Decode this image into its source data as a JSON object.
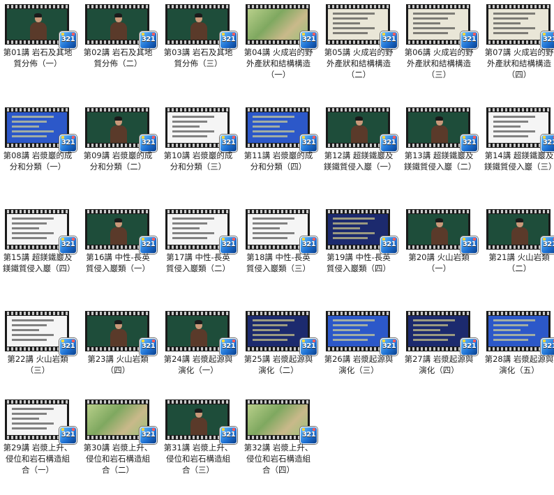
{
  "badge": "321",
  "lectures": [
    {
      "caption": "第01講 岩石及其地質分佈（一）",
      "scene": "board"
    },
    {
      "caption": "第02講 岩石及其地質分佈（二）",
      "scene": "board"
    },
    {
      "caption": "第03講 岩石及其地質分佈（三）",
      "scene": "board"
    },
    {
      "caption": "第04講 火成岩的野外產狀和結構構造（一）",
      "scene": "map"
    },
    {
      "caption": "第05講 火成岩的野外產狀和結構構造（二）",
      "scene": "slide-light"
    },
    {
      "caption": "第06講 火成岩的野外產狀和結構構造（三）",
      "scene": "slide-light"
    },
    {
      "caption": "第07講 火成岩的野外產狀和結構構造（四）",
      "scene": "slide-light"
    },
    {
      "caption": "第08講 岩漿巖的成分和分類（一）",
      "scene": "slide-blue"
    },
    {
      "caption": "第09講 岩漿巖的成分和分類（二）",
      "scene": "board"
    },
    {
      "caption": "第10講 岩漿巖的成分和分類（三）",
      "scene": "slide-white"
    },
    {
      "caption": "第11講 岩漿巖的成分和分類（四）",
      "scene": "slide-blue"
    },
    {
      "caption": "第12講 超鎂鐵巖及鎂鐵質侵入巖（一）",
      "scene": "board"
    },
    {
      "caption": "第13講 超鎂鐵巖及鎂鐵質侵入巖（二）",
      "scene": "board"
    },
    {
      "caption": "第14講 超鎂鐵巖及鎂鐵質侵入巖（三）",
      "scene": "slide-white"
    },
    {
      "caption": "第15講 超鎂鐵巖及鎂鐵質侵入巖（四）",
      "scene": "slide-white"
    },
    {
      "caption": "第16講 中性-長英質侵入巖類（一）",
      "scene": "board"
    },
    {
      "caption": "第17講 中性-長英質侵入巖類（二）",
      "scene": "slide-white"
    },
    {
      "caption": "第18講 中性-長英質侵入巖類（三）",
      "scene": "slide-white"
    },
    {
      "caption": "第19講 中性-長英質侵入巖類（四）",
      "scene": "slide-dark"
    },
    {
      "caption": "第20講 火山岩類（一）",
      "scene": "board"
    },
    {
      "caption": "第21講 火山岩類（二）",
      "scene": "board"
    },
    {
      "caption": "第22講 火山岩類（三）",
      "scene": "slide-white"
    },
    {
      "caption": "第23講 火山岩類（四）",
      "scene": "board"
    },
    {
      "caption": "第24講 岩漿起源與演化（一）",
      "scene": "board"
    },
    {
      "caption": "第25講 岩漿起源與演化（二）",
      "scene": "slide-dark"
    },
    {
      "caption": "第26講 岩漿起源與演化（三）",
      "scene": "slide-blue"
    },
    {
      "caption": "第27講 岩漿起源與演化（四）",
      "scene": "slide-dark"
    },
    {
      "caption": "第28講 岩漿起源與演化（五）",
      "scene": "slide-blue"
    },
    {
      "caption": "第29講 岩漿上升、侵位和岩石構造組合（一）",
      "scene": "slide-white"
    },
    {
      "caption": "第30講 岩漿上升、侵位和岩石構造組合（二）",
      "scene": "map"
    },
    {
      "caption": "第31講 岩漿上升、侵位和岩石構造組合（三）",
      "scene": "board"
    },
    {
      "caption": "第32講 岩漿上升、侵位和岩石構造組合（四）",
      "scene": "map"
    }
  ]
}
